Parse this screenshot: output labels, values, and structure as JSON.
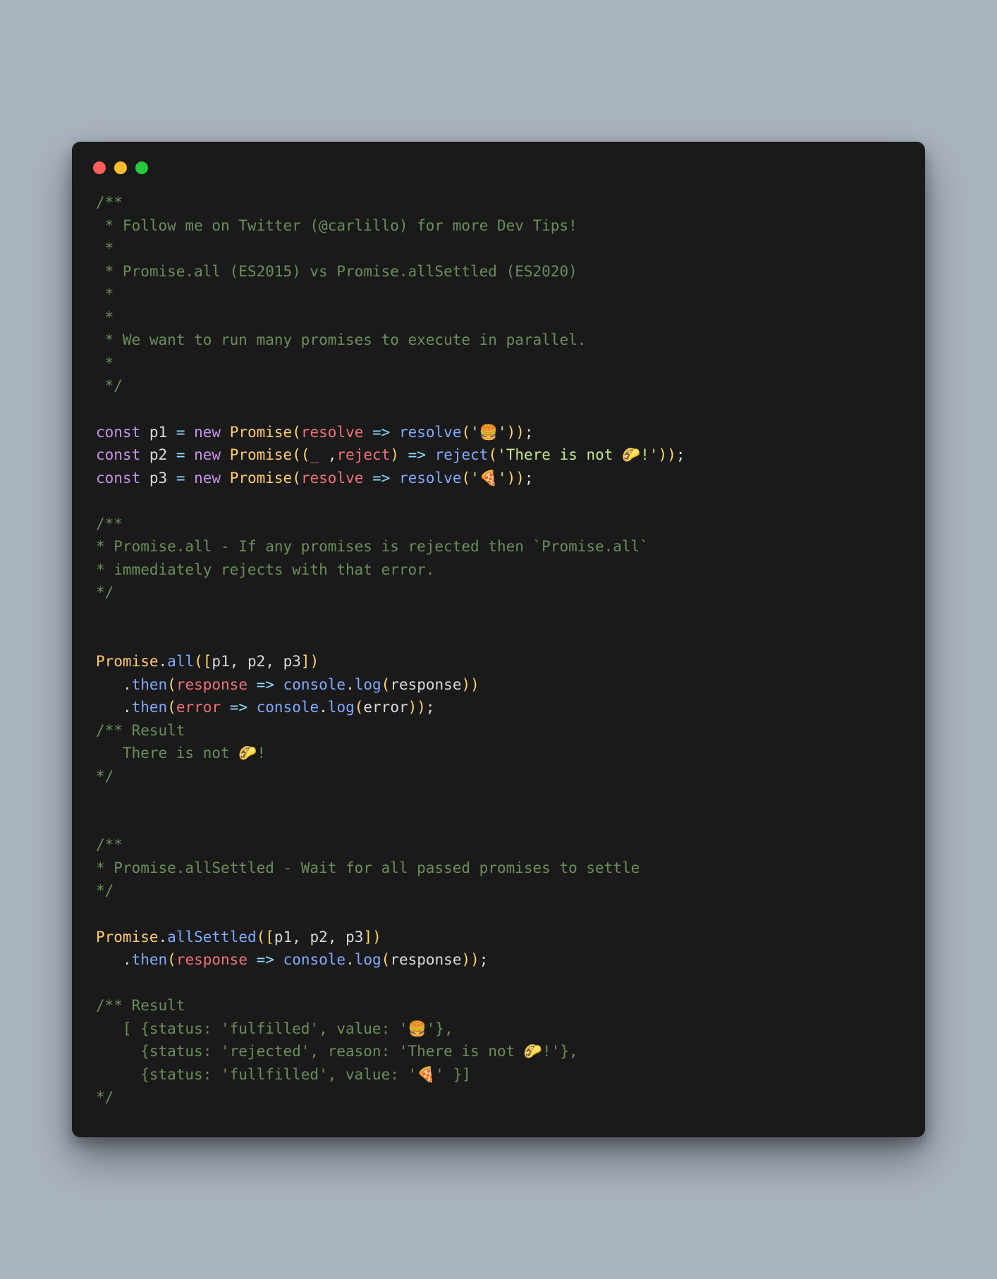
{
  "window": {
    "traffic": {
      "red": "#ff5f56",
      "yellow": "#ffbd2e",
      "green": "#27c93f"
    }
  },
  "code": {
    "comment1_l1": "/**",
    "comment1_l2": " * Follow me on Twitter (@carlillo) for more Dev Tips!",
    "comment1_l3": " *",
    "comment1_l4": " * Promise.all (ES2015) vs Promise.allSettled (ES2020)",
    "comment1_l5": " *",
    "comment1_l6": " *",
    "comment1_l7": " * We want to run many promises to execute in parallel.",
    "comment1_l8": " *",
    "comment1_l9": " */",
    "kw_const": "const",
    "kw_new": "new",
    "p1": "p1",
    "p2": "p2",
    "p3": "p3",
    "eq": " = ",
    "Promise": "Promise",
    "lp": "(",
    "rp": ")",
    "lb": "[",
    "rb": "]",
    "comma": ", ",
    "comma_sp": " ,",
    "semi": ";",
    "arrow": " => ",
    "resolve": "resolve",
    "reject": "reject",
    "underscore": "_",
    "str_burger": "'🍔'",
    "str_taco": "'There is not 🌮!'",
    "str_pizza": "'🍕'",
    "comment2_l1": "/**",
    "comment2_l2": "* Promise.all - If any promises is rejected then `Promise.all`",
    "comment2_l3": "* immediately rejects with that error.",
    "comment2_l4": "*/",
    "dot": ".",
    "all": "all",
    "allSettled": "allSettled",
    "then": "then",
    "response": "response",
    "error": "error",
    "console": "console",
    "log": "log",
    "indent3": "   ",
    "comment3_l1": "/** Result",
    "comment3_l2": "   There is not 🌮!",
    "comment3_l3": "*/",
    "comment4_l1": "/**",
    "comment4_l2": "* Promise.allSettled - Wait for all passed promises to settle",
    "comment4_l3": "*/",
    "comment5_l1": "/** Result",
    "comment5_l2": "   [ {status: 'fulfilled', value: '🍔'},",
    "comment5_l3": "     {status: 'rejected', reason: 'There is not 🌮!'},",
    "comment5_l4": "     {status: 'fullfilled', value: '🍕' }]",
    "comment5_l5": "*/"
  }
}
